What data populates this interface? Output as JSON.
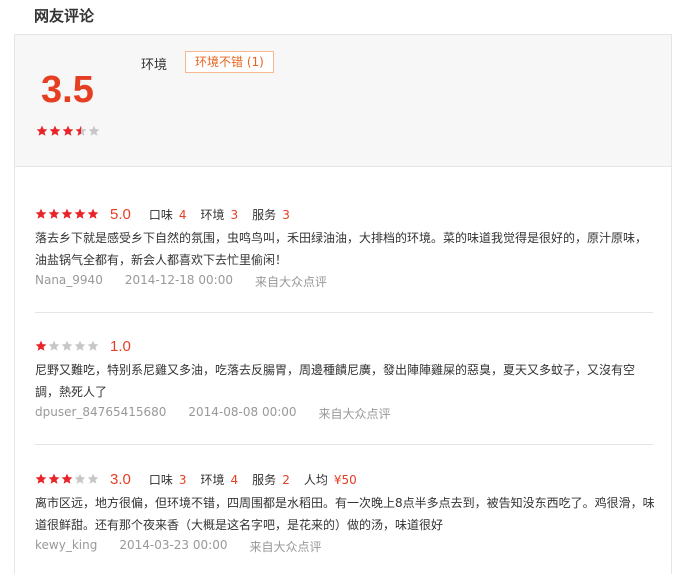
{
  "section_title": "网友评论",
  "summary": {
    "score": "3.5",
    "rating": 3.5,
    "tag_label": "环境",
    "tag_button": "环境不错 (1)"
  },
  "colors": {
    "accent": "#e63e22",
    "star_on": "#e8242b",
    "star_off": "#c7c7c7",
    "tag_border": "#f5b891"
  },
  "reviews": [
    {
      "rating": 5,
      "score": "5.0",
      "subs": [
        {
          "label": "口味",
          "value": "4"
        },
        {
          "label": "环境",
          "value": "3"
        },
        {
          "label": "服务",
          "value": "3"
        }
      ],
      "text": "落去乡下就是感受乡下自然的氛围，虫鸣鸟叫，禾田绿油油，大排档的环境。菜的味道我觉得是很好的，原汁原味，油盐锅气全都有，新会人都喜欢下去忙里偷闲！",
      "user": "Nana_9940",
      "date": "2014-12-18 00:00",
      "source": "来自大众点评"
    },
    {
      "rating": 1,
      "score": "1.0",
      "subs": [],
      "text": "尼野又難吃，特别系尼雞又多油，吃落去反腸胃，周邊種饋尼廣，發出陣陣雞屎的惡臭，夏天又多蚊子，又沒有空調，熱死人了",
      "user": "dpuser_84765415680",
      "date": "2014-08-08 00:00",
      "source": "来自大众点评"
    },
    {
      "rating": 3,
      "score": "3.0",
      "subs": [
        {
          "label": "口味",
          "value": "3"
        },
        {
          "label": "环境",
          "value": "4"
        },
        {
          "label": "服务",
          "value": "2"
        },
        {
          "label": "人均",
          "value": "¥50"
        }
      ],
      "text": "离市区远，地方很偏，但环境不错，四周围都是水稻田。有一次晚上8点半多点去到，被告知没东西吃了。鸡很滑，味道很鲜甜。还有那个夜来香（大概是这名字吧，是花来的）做的汤，味道很好",
      "user": "kewy_king",
      "date": "2014-03-23 00:00",
      "source": "来自大众点评"
    }
  ]
}
